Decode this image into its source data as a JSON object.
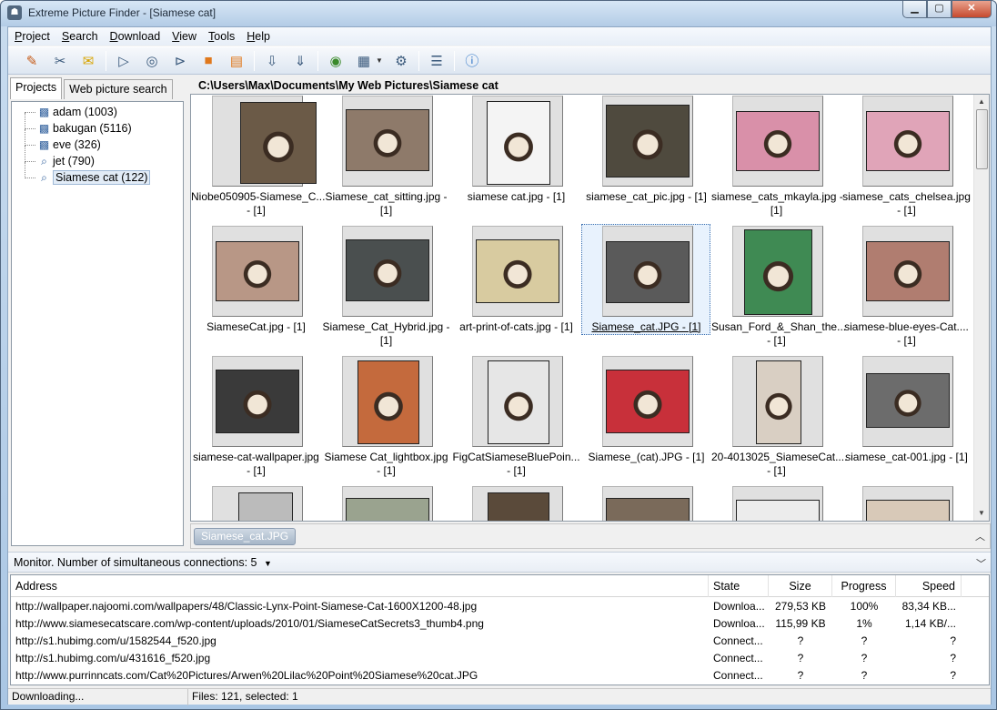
{
  "window": {
    "title": "Extreme Picture Finder - [Siamese cat]"
  },
  "menu": [
    "Project",
    "Search",
    "Download",
    "View",
    "Tools",
    "Help"
  ],
  "left_tabs": {
    "projects": "Projects",
    "web_search": "Web picture search"
  },
  "tree": [
    {
      "label": "adam (1003)",
      "icon": "project-grid-icon"
    },
    {
      "label": "bakugan (5116)",
      "icon": "project-grid-icon"
    },
    {
      "label": "eve (326)",
      "icon": "project-grid-icon"
    },
    {
      "label": "jet (790)",
      "icon": "search-project-icon"
    },
    {
      "label": "Siamese cat (122)",
      "icon": "search-project-icon"
    }
  ],
  "path": "C:\\Users\\Max\\Documents\\My Web Pictures\\Siamese cat",
  "thumbnails": [
    {
      "l1": "Niobe050905-Siamese_C...",
      "l2": "- [1]"
    },
    {
      "l1": "Siamese_cat_sitting.jpg -",
      "l2": "[1]"
    },
    {
      "l1": "siamese cat.jpg - [1]",
      "l2": ""
    },
    {
      "l1": "siamese_cat_pic.jpg - [1]",
      "l2": ""
    },
    {
      "l1": "siamese_cats_mkayla.jpg -",
      "l2": "[1]"
    },
    {
      "l1": "siamese_cats_chelsea.jpg",
      "l2": "- [1]"
    },
    {
      "l1": "SiameseCat.jpg - [1]",
      "l2": ""
    },
    {
      "l1": "Siamese_Cat_Hybrid.jpg -",
      "l2": "[1]"
    },
    {
      "l1": "art-print-of-cats.jpg - [1]",
      "l2": ""
    },
    {
      "l1": "Siamese_cat.JPG - [1]",
      "l2": ""
    },
    {
      "l1": "Susan_Ford_&_Shan_the...",
      "l2": "- [1]"
    },
    {
      "l1": "siamese-blue-eyes-Cat....",
      "l2": "- [1]"
    },
    {
      "l1": "siamese-cat-wallpaper.jpg",
      "l2": "- [1]"
    },
    {
      "l1": "Siamese Cat_lightbox.jpg",
      "l2": "- [1]"
    },
    {
      "l1": "FigCatSiameseBluePoin...",
      "l2": "- [1]"
    },
    {
      "l1": "Siamese_(cat).JPG - [1]",
      "l2": ""
    },
    {
      "l1": "20-4013025_SiameseCat....",
      "l2": "- [1]"
    },
    {
      "l1": "siamese_cat-001.jpg - [1]",
      "l2": ""
    },
    {
      "l1": "",
      "l2": ""
    },
    {
      "l1": "",
      "l2": ""
    },
    {
      "l1": "",
      "l2": ""
    },
    {
      "l1": "",
      "l2": ""
    },
    {
      "l1": "",
      "l2": ""
    },
    {
      "l1": "",
      "l2": ""
    }
  ],
  "selection_chip": "Siamese_cat.JPG",
  "monitor": {
    "label": "Monitor. Number of simultaneous connections: 5"
  },
  "downloads": {
    "columns": [
      "Address",
      "State",
      "Size",
      "Progress",
      "Speed"
    ],
    "rows": [
      {
        "address": "http://wallpaper.najoomi.com/wallpapers/48/Classic-Lynx-Point-Siamese-Cat-1600X1200-48.jpg",
        "state": "Downloa...",
        "size": "279,53 KB",
        "progress": "100%",
        "speed": "83,34 KB..."
      },
      {
        "address": "http://www.siamesecatscare.com/wp-content/uploads/2010/01/SiameseCatSecrets3_thumb4.png",
        "state": "Downloa...",
        "size": "115,99 KB",
        "progress": "1%",
        "speed": "1,14 KB/..."
      },
      {
        "address": "http://s1.hubimg.com/u/1582544_f520.jpg",
        "state": "Connect...",
        "size": "?",
        "progress": "?",
        "speed": "?"
      },
      {
        "address": "http://s1.hubimg.com/u/431616_f520.jpg",
        "state": "Connect...",
        "size": "?",
        "progress": "?",
        "speed": "?"
      },
      {
        "address": "http://www.purrinncats.com/Cat%20Pictures/Arwen%20Lilac%20Point%20Siamese%20cat.JPG",
        "state": "Connect...",
        "size": "?",
        "progress": "?",
        "speed": "?"
      }
    ]
  },
  "status": {
    "left": "Downloading...",
    "files": "Files: 121, selected: 1"
  }
}
